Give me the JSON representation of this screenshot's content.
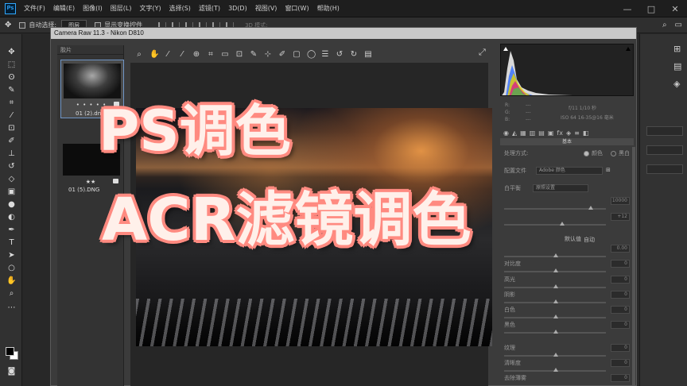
{
  "menubar": {
    "logo": "Ps",
    "items": [
      "文件(F)",
      "编辑(E)",
      "图像(I)",
      "图层(L)",
      "文字(Y)",
      "选择(S)",
      "滤镜(T)",
      "3D(D)",
      "视图(V)",
      "窗口(W)",
      "帮助(H)"
    ],
    "controls": [
      "—",
      "□",
      "✕"
    ]
  },
  "options_bar": {
    "auto_select_label": "自动选择:",
    "auto_select_value": "图层",
    "show_transform_label": "显示变换控件",
    "mode_3d_label": "3D 模式:"
  },
  "acr": {
    "title": "Camera Raw 11.3  -  Nikon D810",
    "filmstrip_header": "胶片",
    "thumbs": [
      {
        "stars": "• • • • •",
        "name": "01 (2).dng"
      },
      {
        "stars": "★★",
        "name": "01 (5).DNG"
      }
    ],
    "readout": {
      "r": "R:",
      "g": "G:",
      "b": "B:",
      "dash1": "---",
      "dash2": "---",
      "dash3": "---",
      "exposure": "f/11  1/10 秒",
      "iso": "ISO 64   16-35@16 毫米"
    },
    "panel_title": "基本",
    "treatment_label": "处理方式:",
    "treatment_color": "颜色",
    "treatment_bw": "黑白",
    "profile_label": "配置文件",
    "profile_value": "Adobe 颜色",
    "wb_label": "白平衡",
    "wb_value": "原照设置",
    "temp_value": "10000",
    "tint_value": "+12",
    "auto_label": "自动",
    "default_label": "默认值",
    "exposure_value": "0.00",
    "sliders": [
      {
        "label": "对比度",
        "value": "0"
      },
      {
        "label": "高光",
        "value": "0"
      },
      {
        "label": "阴影",
        "value": "0"
      },
      {
        "label": "白色",
        "value": "0"
      },
      {
        "label": "黑色",
        "value": "0"
      },
      {
        "label": "纹理",
        "value": "0"
      },
      {
        "label": "清晰度",
        "value": "0"
      },
      {
        "label": "去除薄雾",
        "value": "0"
      }
    ]
  },
  "overlay": {
    "line1": "PS调色",
    "line2": "ACR滤镜调色"
  },
  "colors": {
    "overlay_fill": "#fff0ea",
    "overlay_stroke": "#ff7f77",
    "selection_border": "#6f95c6"
  }
}
